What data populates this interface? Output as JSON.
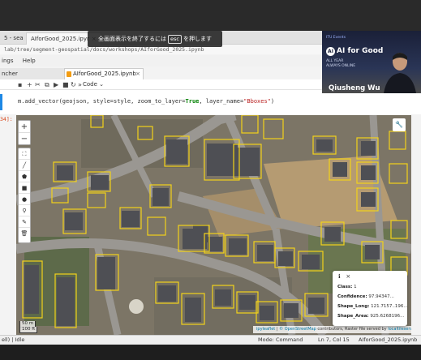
{
  "browser": {
    "tabs": [
      {
        "label": "5 - sea"
      },
      {
        "label": "AIforGood_2025.ipyr"
      }
    ],
    "url": "lab/tree/segment-geospatial/docs/workshops/AIforGood_2025.ipynb"
  },
  "fullscreen_notice": {
    "before": "全画面表示を終了するには",
    "key": "esc",
    "after": "を押します"
  },
  "jupyter": {
    "menu": [
      "ings",
      "Help"
    ],
    "launcher_label": "ncher",
    "notebook_tab": "AIforGood_2025.ipynb",
    "cell_type": "Code",
    "prompt": "34]:",
    "code": {
      "object": "m.add_vector(geojson, style=style, zoom_to_layer=",
      "kw_true": "True",
      "mid": ", layer_name=",
      "string": "\"Bboxes\"",
      "close": ")"
    }
  },
  "map": {
    "scale_top": "50 m",
    "scale_bottom": "100 ft",
    "attribution_leaflet": "ipyleaflet",
    "attribution_osm": "© OpenStreetMap",
    "attribution_rest": "contributors, Raster file served by",
    "attribution_server": "localtileserver",
    "box_color": "#f2d21a",
    "popup": {
      "class_label": "Class:",
      "class_value": "1",
      "confidence_label": "Confidence:",
      "confidence_value": "97.94347...",
      "shape_long_label": "Shape_Long:",
      "shape_long_value": "121.7157..196...",
      "shape_area_label": "Shape_Area:",
      "shape_area_value": "925.6268196..."
    }
  },
  "status": {
    "kernel": "ell) | Idle",
    "mode": "Mode: Command",
    "position": "Ln 7, Col 15",
    "file": "AIforGood_2025.ipynb"
  },
  "presenter": {
    "events_label": "ITU Events",
    "brand": "AI for Good",
    "tag_line_1": "ALL YEAR",
    "tag_line_2": "ALWAYS ONLINE",
    "name": "Qiusheng Wu"
  }
}
